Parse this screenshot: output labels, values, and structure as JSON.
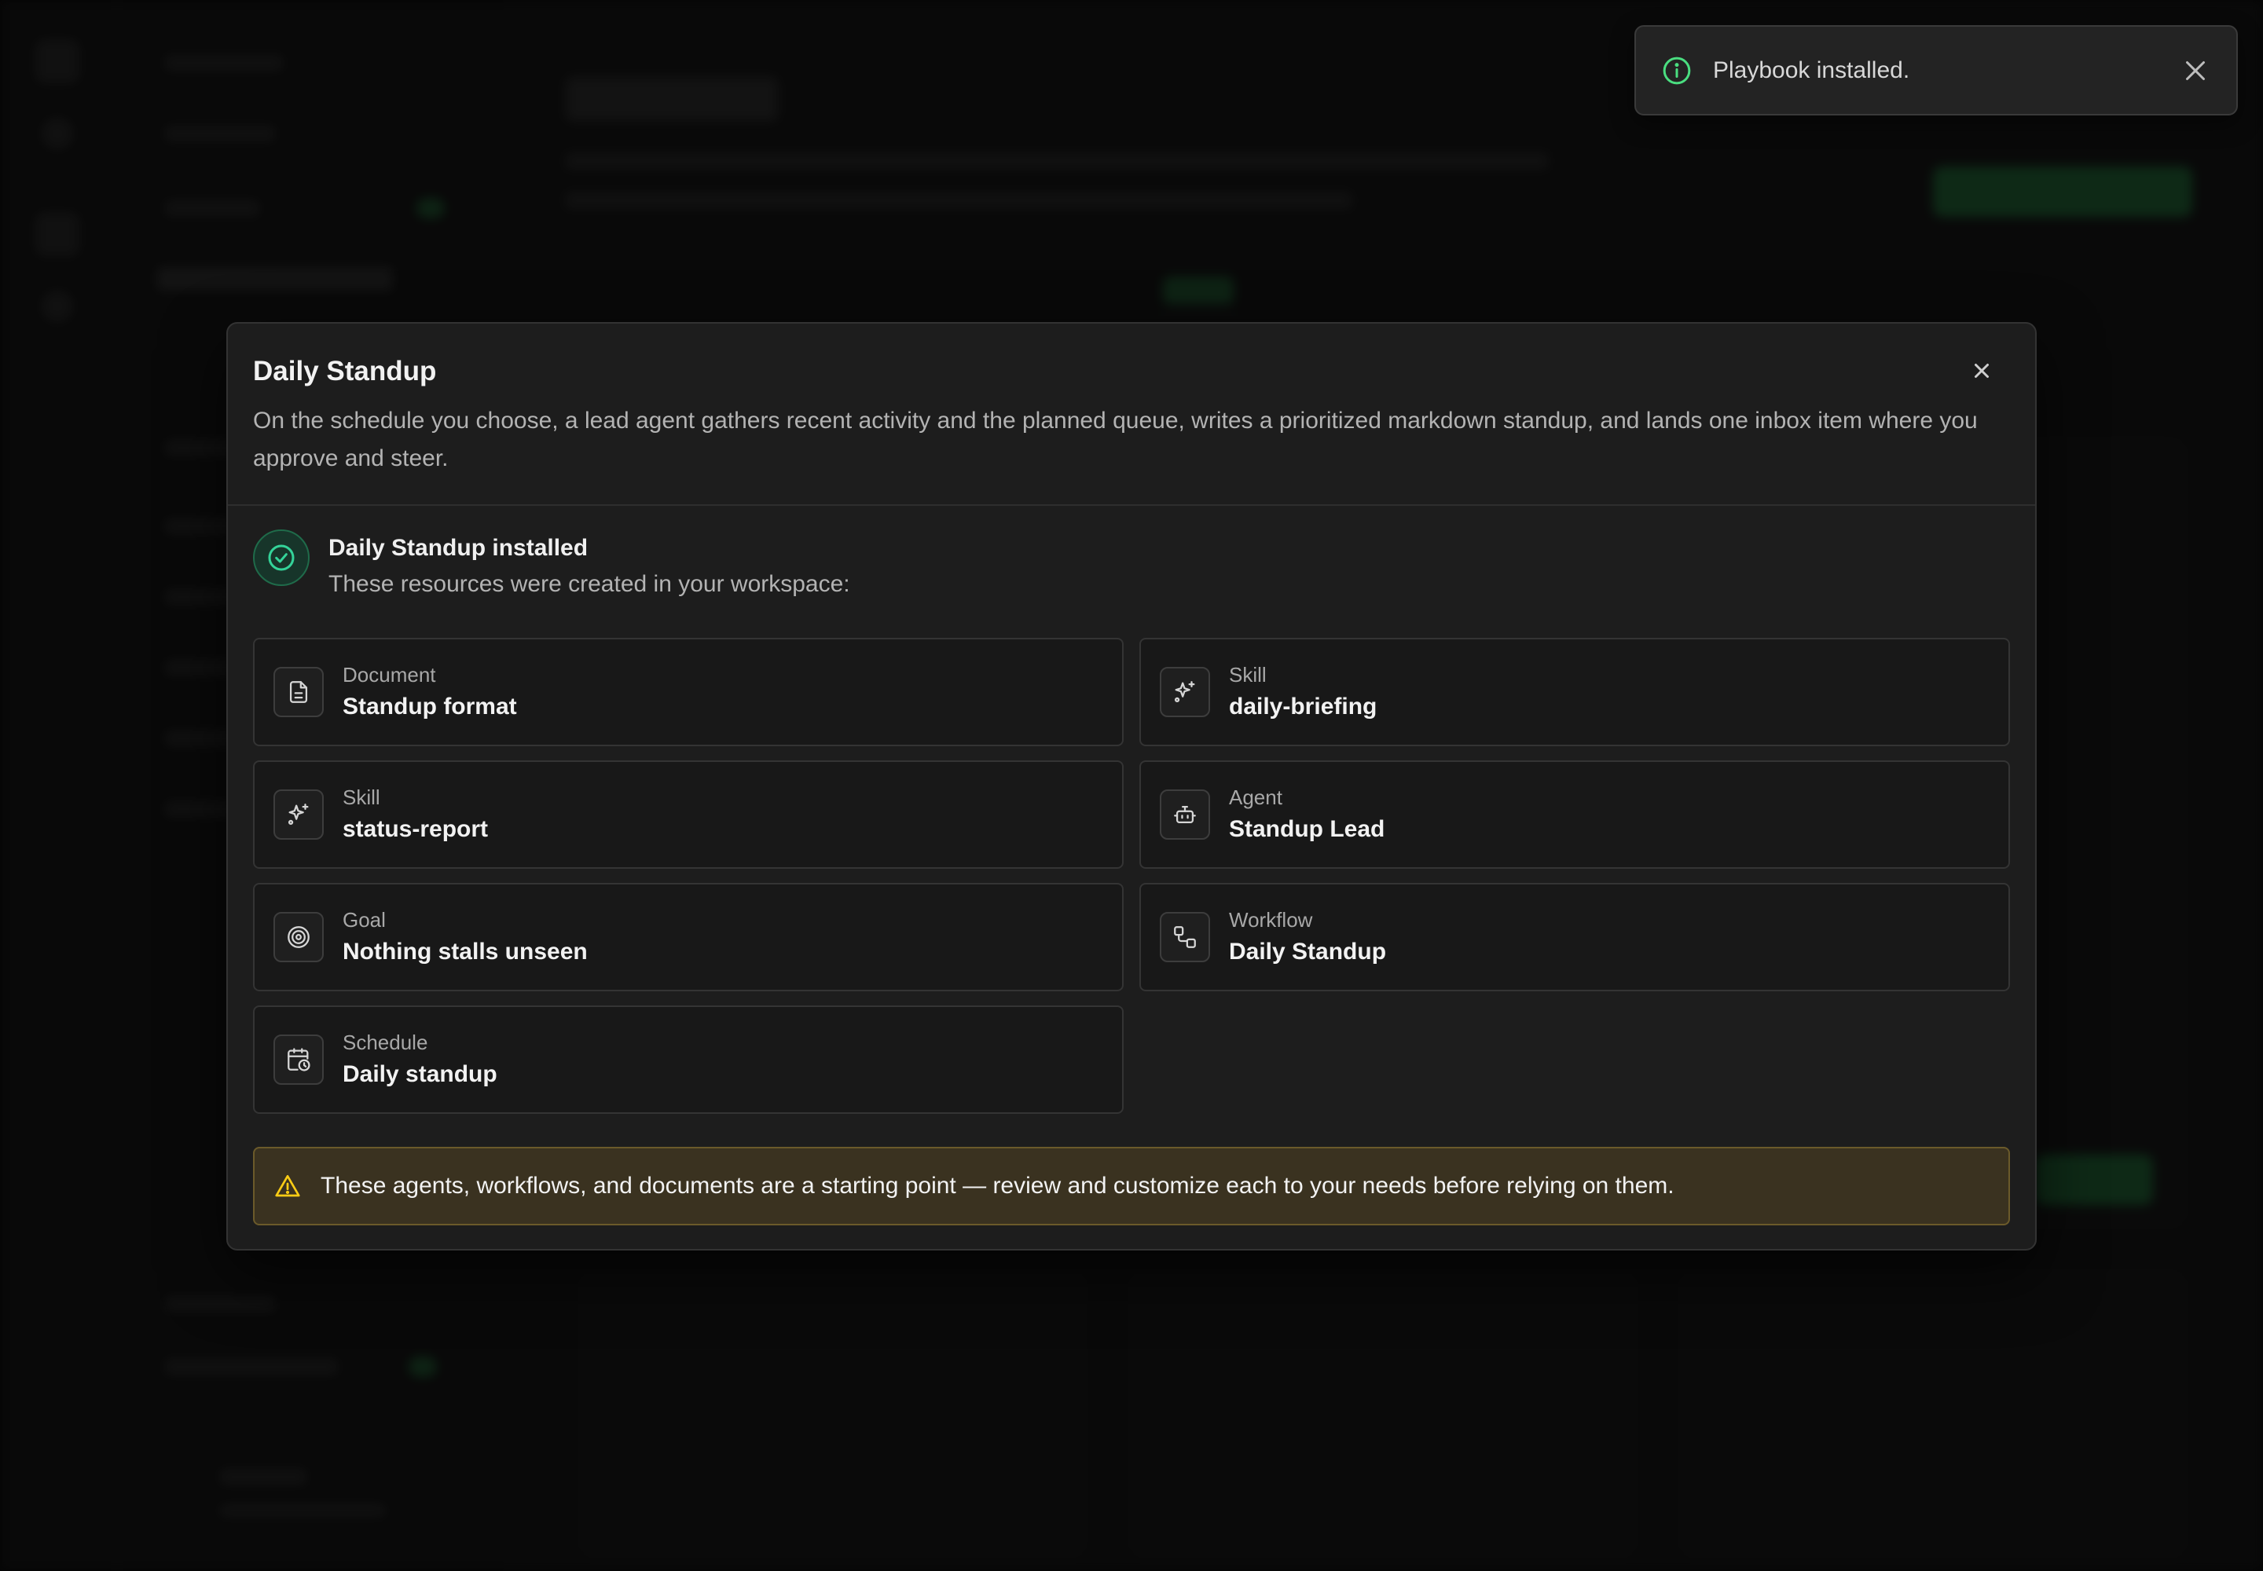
{
  "toast": {
    "message": "Playbook installed.",
    "icon": "info-icon",
    "accent": "#4ade80"
  },
  "modal": {
    "title": "Daily Standup",
    "description": "On the schedule you choose, a lead agent gathers recent activity and the planned queue, writes a prioritized markdown standup, and lands one inbox item where you approve and steer.",
    "success": {
      "title": "Daily Standup installed",
      "subtitle": "These resources were created in your workspace:",
      "accent": "#34d399"
    },
    "resources": [
      {
        "type": "Document",
        "name": "Standup format",
        "icon": "document-icon"
      },
      {
        "type": "Skill",
        "name": "daily-briefing",
        "icon": "sparkles-icon"
      },
      {
        "type": "Skill",
        "name": "status-report",
        "icon": "sparkles-icon"
      },
      {
        "type": "Agent",
        "name": "Standup Lead",
        "icon": "bot-icon"
      },
      {
        "type": "Goal",
        "name": "Nothing stalls unseen",
        "icon": "target-icon"
      },
      {
        "type": "Workflow",
        "name": "Daily Standup",
        "icon": "workflow-icon"
      },
      {
        "type": "Schedule",
        "name": "Daily standup",
        "icon": "calendar-clock-icon"
      }
    ],
    "warning": {
      "text": "These agents, workflows, and documents are a starting point — review and customize each to your needs before relying on them.",
      "accent": "#facc15"
    }
  }
}
